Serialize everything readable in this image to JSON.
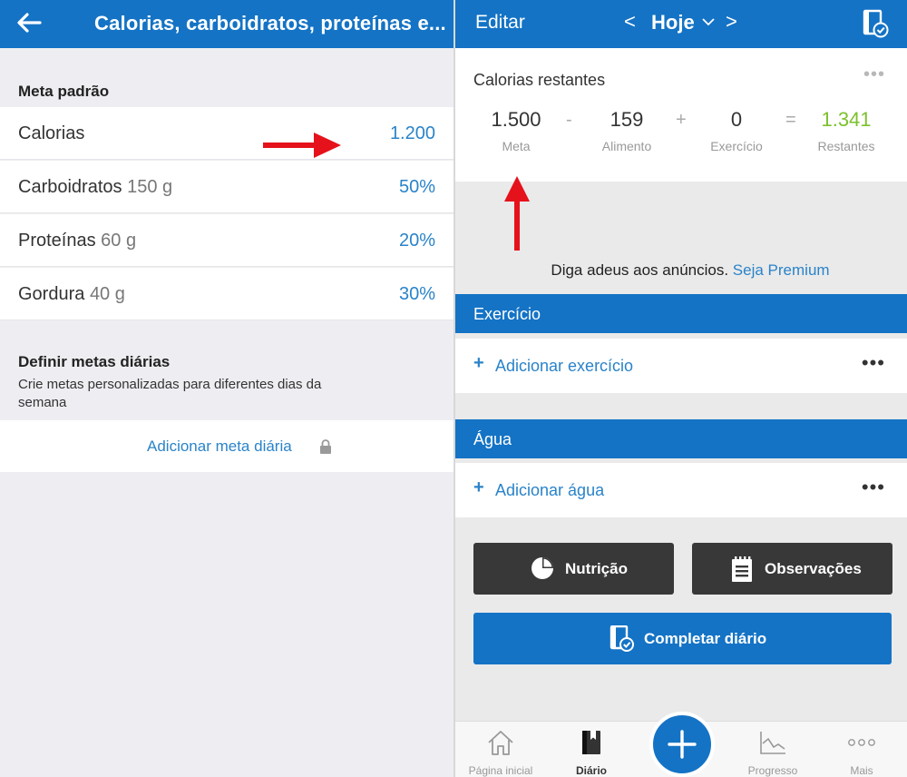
{
  "left_panel": {
    "title": "Calorias, carboidratos, proteínas e...",
    "section_default": "Meta padrão",
    "rows": [
      {
        "label": "Calorias",
        "amount": "",
        "value": "1.200"
      },
      {
        "label": "Carboidratos",
        "amount": "150  g",
        "value": "50%"
      },
      {
        "label": "Proteínas",
        "amount": "60  g",
        "value": "20%"
      },
      {
        "label": "Gordura",
        "amount": "40  g",
        "value": "30%"
      }
    ],
    "section_daily": "Definir metas diárias",
    "daily_description": "Crie metas personalizadas para diferentes dias da semana",
    "add_daily_label": "Adicionar meta diária"
  },
  "right_panel": {
    "edit_label": "Editar",
    "prev_symbol": "<",
    "date_label": "Hoje",
    "next_symbol": ">",
    "calories": {
      "title": "Calorias restantes",
      "more": "•••",
      "goal": {
        "value": "1.500",
        "caption": "Meta"
      },
      "food": {
        "value": "159",
        "caption": "Alimento"
      },
      "exercise": {
        "value": "0",
        "caption": "Exercício"
      },
      "remaining": {
        "value": "1.341",
        "caption": "Restantes"
      },
      "op_minus": "-",
      "op_plus": "+",
      "op_equals": "="
    },
    "promo": {
      "text": "Diga adeus aos anúncios.",
      "link": "Seja Premium"
    },
    "exercise": {
      "header": "Exercício",
      "plus": "+",
      "add_label": "Adicionar exercício",
      "more": "•••"
    },
    "water": {
      "header": "Água",
      "plus": "+",
      "add_label": "Adicionar água",
      "more": "•••"
    },
    "buttons": {
      "nutrition": "Nutrição",
      "notes": "Observações",
      "complete": "Completar diário"
    },
    "tabs": [
      {
        "label": "Página inicial",
        "icon": "home-icon"
      },
      {
        "label": "Diário",
        "icon": "diary-book-icon"
      },
      {
        "label": "Progresso",
        "icon": "chart-icon"
      },
      {
        "label": "Mais",
        "icon": "more-dots-icon"
      }
    ]
  },
  "colors": {
    "primary_blue": "#1473c5",
    "link_blue": "#2a83c9",
    "remaining_green": "#7cc12d",
    "annotation_red": "#e5121b",
    "dark_button": "#383838"
  }
}
